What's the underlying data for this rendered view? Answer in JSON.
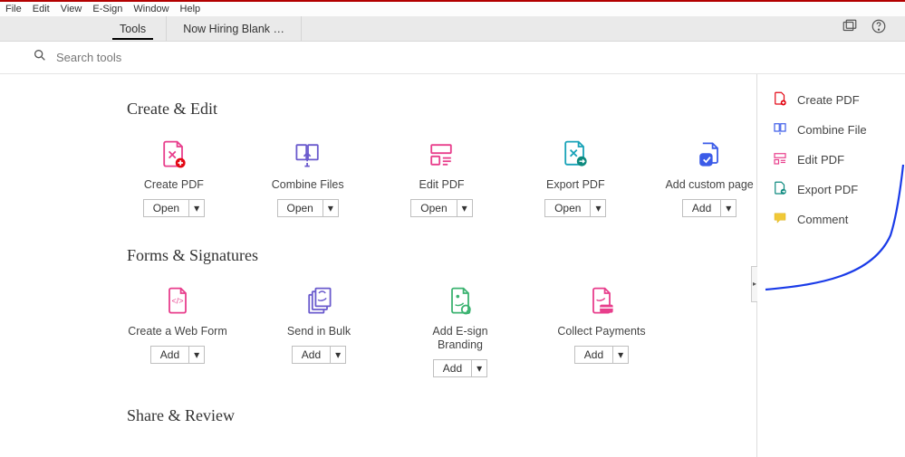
{
  "menu": {
    "items": [
      "File",
      "Edit",
      "View",
      "E-Sign",
      "Window",
      "Help"
    ]
  },
  "tabs": {
    "tools": "Tools",
    "document": "Now Hiring Blank …"
  },
  "search": {
    "placeholder": "Search tools"
  },
  "sections": {
    "create_edit": {
      "title": "Create & Edit",
      "tools": [
        {
          "label": "Create PDF",
          "button": "Open"
        },
        {
          "label": "Combine Files",
          "button": "Open"
        },
        {
          "label": "Edit PDF",
          "button": "Open"
        },
        {
          "label": "Export PDF",
          "button": "Open"
        },
        {
          "label": "Add custom page",
          "button": "Add"
        }
      ]
    },
    "forms_sign": {
      "title": "Forms & Signatures",
      "tools": [
        {
          "label": "Create a Web Form",
          "button": "Add"
        },
        {
          "label": "Send in Bulk",
          "button": "Add"
        },
        {
          "label": "Add E-sign Branding",
          "button": "Add"
        },
        {
          "label": "Collect Payments",
          "button": "Add"
        }
      ]
    },
    "share_review": {
      "title": "Share & Review"
    }
  },
  "rightrail": {
    "items": [
      {
        "label": "Create PDF"
      },
      {
        "label": "Combine File"
      },
      {
        "label": "Edit PDF"
      },
      {
        "label": "Export PDF"
      },
      {
        "label": "Comment"
      }
    ]
  },
  "caret": "▾"
}
